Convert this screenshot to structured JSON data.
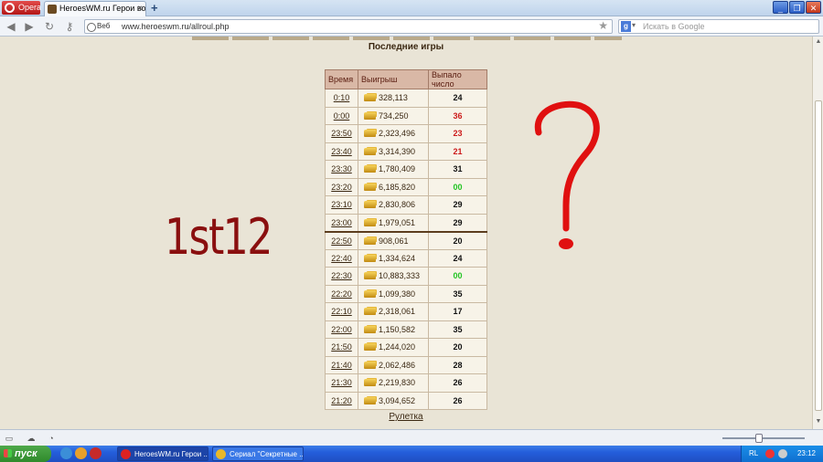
{
  "browser": {
    "menu_label": "Opera",
    "tab_title": "HeroesWM.ru Герои вой...",
    "url": "www.heroeswm.ru/allroul.php",
    "url_badge": "Веб",
    "search_placeholder": "Искать в Google"
  },
  "page": {
    "heading": "Последние игры",
    "columns": [
      "Время",
      "Выигрыш",
      "Выпало число"
    ],
    "rows": [
      {
        "time": "0:10",
        "win": "328,113",
        "num": "24",
        "color": "black"
      },
      {
        "time": "0:00",
        "win": "734,250",
        "num": "36",
        "color": "red"
      },
      {
        "time": "23:50",
        "win": "2,323,496",
        "num": "23",
        "color": "red"
      },
      {
        "time": "23:40",
        "win": "3,314,390",
        "num": "21",
        "color": "red"
      },
      {
        "time": "23:30",
        "win": "1,780,409",
        "num": "31",
        "color": "black"
      },
      {
        "time": "23:20",
        "win": "6,185,820",
        "num": "00",
        "color": "green"
      },
      {
        "time": "23:10",
        "win": "2,830,806",
        "num": "29",
        "color": "black"
      },
      {
        "time": "23:00",
        "win": "1,979,051",
        "num": "29",
        "color": "black"
      },
      {
        "time": "22:50",
        "win": "908,061",
        "num": "20",
        "color": "black"
      },
      {
        "time": "22:40",
        "win": "1,334,624",
        "num": "24",
        "color": "black"
      },
      {
        "time": "22:30",
        "win": "10,883,333",
        "num": "00",
        "color": "green"
      },
      {
        "time": "22:20",
        "win": "1,099,380",
        "num": "35",
        "color": "black"
      },
      {
        "time": "22:10",
        "win": "2,318,061",
        "num": "17",
        "color": "black"
      },
      {
        "time": "22:00",
        "win": "1,150,582",
        "num": "35",
        "color": "black"
      },
      {
        "time": "21:50",
        "win": "1,244,020",
        "num": "20",
        "color": "black"
      },
      {
        "time": "21:40",
        "win": "2,062,486",
        "num": "28",
        "color": "black"
      },
      {
        "time": "21:30",
        "win": "2,219,830",
        "num": "26",
        "color": "black"
      },
      {
        "time": "21:20",
        "win": "3,094,652",
        "num": "26",
        "color": "black"
      }
    ],
    "footer_link": "Рулетка",
    "annotation_text": "1st12",
    "annotation_color": "#8a0f0f",
    "question_mark_color": "#e01010"
  },
  "taskbar": {
    "start_label": "пуск",
    "tasks": [
      "HeroesWM.ru Герои ...",
      "Сериал \"Секретные ..."
    ],
    "lang": "RL",
    "clock": "23:12"
  }
}
